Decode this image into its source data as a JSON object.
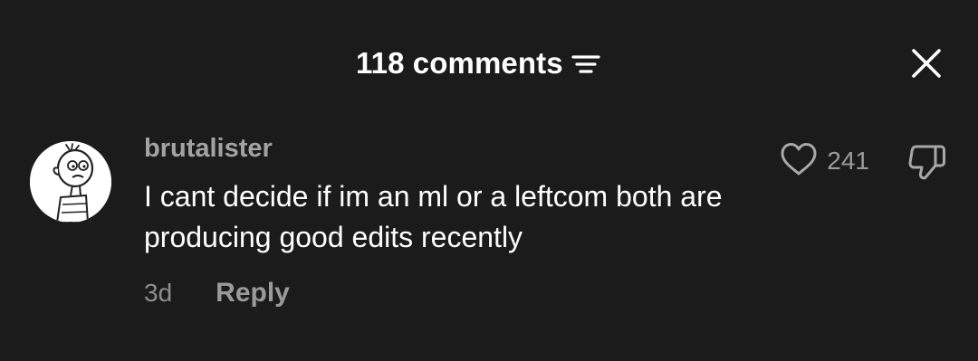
{
  "header": {
    "title": "118 comments",
    "sort_icon": "sort-filter-icon",
    "close_icon": "close-icon"
  },
  "comment": {
    "username": "brutalister",
    "text_lines": [
      "I cant decide if im an ml or a leftcom both are",
      "producing good edits recently"
    ],
    "timestamp": "3d",
    "reply_label": "Reply",
    "like_count": "241",
    "avatar_icon": "cartoon-avatar-icon",
    "like_icon": "heart-icon",
    "dislike_icon": "thumbs-down-icon"
  },
  "colors": {
    "background": "#1b1b1b",
    "primary_text": "#ffffff",
    "secondary_text": "#a3a3a3",
    "muted_text": "#8e8e8e"
  }
}
